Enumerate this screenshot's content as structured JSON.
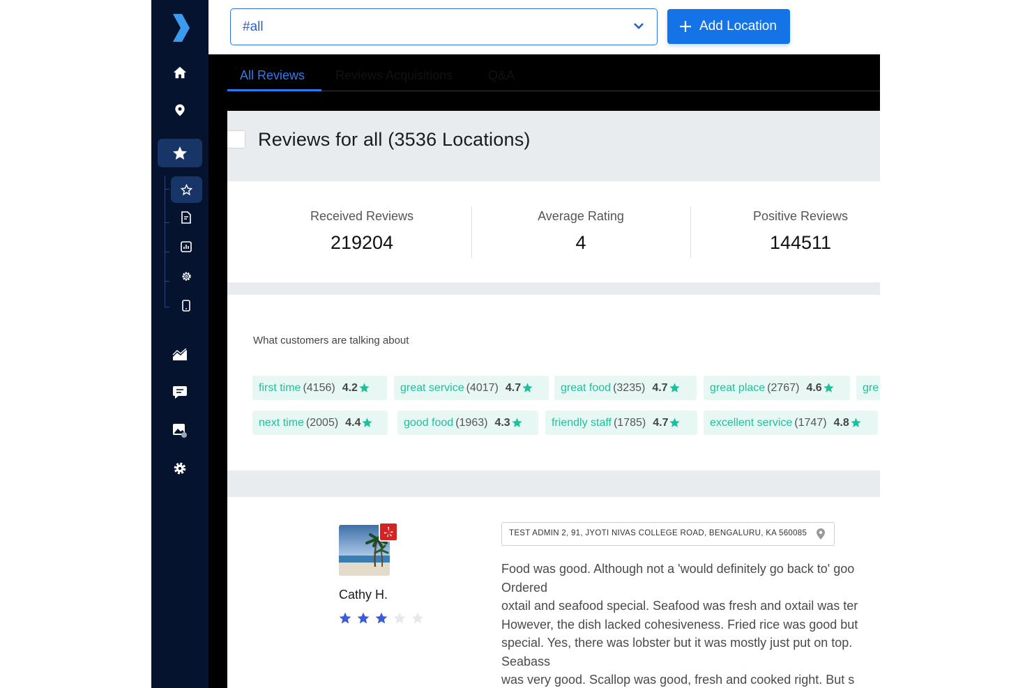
{
  "location_select": {
    "value": "#all"
  },
  "add_location_label": "Add Location",
  "tabs": [
    {
      "label": "All Reviews",
      "active": true
    },
    {
      "label": "Reviews Acquisitions",
      "active": false
    },
    {
      "label": "Q&A",
      "active": false
    }
  ],
  "page_title": "Reviews for all (3536 Locations)",
  "stats": [
    {
      "label": "Received Reviews",
      "value": "219204"
    },
    {
      "label": "Average Rating",
      "value": "4"
    },
    {
      "label": "Positive Reviews",
      "value": "144511"
    }
  ],
  "topics": {
    "title": "What customers are talking about",
    "chips": [
      {
        "keyword": "first time",
        "count": "(4156)",
        "rating": "4.2"
      },
      {
        "keyword": "great service",
        "count": "(4017)",
        "rating": "4.7"
      },
      {
        "keyword": "great food",
        "count": "(3235)",
        "rating": "4.7"
      },
      {
        "keyword": "great place",
        "count": "(2767)",
        "rating": "4.6"
      },
      {
        "keyword": "gre",
        "count": "",
        "rating": ""
      },
      {
        "keyword": "next time",
        "count": "(2005)",
        "rating": "4.4"
      },
      {
        "keyword": "good food",
        "count": "(1963)",
        "rating": "4.3"
      },
      {
        "keyword": "friendly staff",
        "count": "(1785)",
        "rating": "4.7"
      },
      {
        "keyword": "excellent service",
        "count": "(1747)",
        "rating": "4.8"
      }
    ]
  },
  "review": {
    "reviewer": "Cathy H.",
    "rating": 3,
    "max_rating": 5,
    "address": "TEST ADMIN 2, 91, JYOTI NIVAS COLLEGE ROAD, BENGALURU, KA 560085",
    "text_lines": [
      "Food was good. Although not a 'would definitely go back to' goo",
      "Ordered",
      "oxtail and seafood special. Seafood was fresh and oxtail was ter",
      "However, the dish lacked cohesiveness. Fried rice was good but",
      "special. Yes, there was lobster but it was mostly just put on top.",
      "Seabass",
      "was very good. Scallop was good, fresh and cooked right. But s"
    ]
  },
  "colors": {
    "sidebar": "#05132f",
    "accent": "#1473e6",
    "chip_bg": "#e7f8f4",
    "chip_keyword": "#1fbf9b",
    "star_review": "#3b5bdb",
    "yelp": "#d32323"
  },
  "icons": [
    "logo-chevron-icon",
    "home-icon",
    "location-pin-icon",
    "star-icon",
    "star-outline-icon",
    "document-icon",
    "bar-chart-icon",
    "gear-icon",
    "phone-icon",
    "area-chart-icon",
    "chat-icon",
    "image-icon",
    "settings-icon",
    "chevron-down-icon",
    "plus-icon",
    "yelp-icon",
    "map-pin-icon"
  ]
}
